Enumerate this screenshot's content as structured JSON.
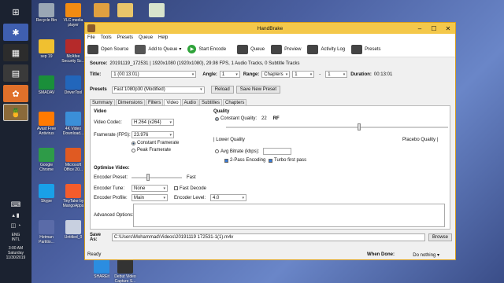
{
  "desktop": {
    "icons": [
      {
        "label": "Recycle Bin",
        "color": "#9aa7b5"
      },
      {
        "label": "VLC media player",
        "color": "#f28b12"
      },
      {
        "label": "",
        "color": "#e0a040"
      },
      {
        "label": "",
        "color": "#e8c56a"
      },
      {
        "label": "",
        "color": "#d8e4cc"
      },
      {
        "label": "sep 19",
        "color": "#f0c030"
      },
      {
        "label": "McAfee Security Sc...",
        "color": "#b52a2a"
      },
      {
        "label": "SMADAV",
        "color": "#1a8f3a"
      },
      {
        "label": "DriverTool",
        "color": "#2266bb"
      },
      {
        "label": "Avast Free Antivirus",
        "color": "#ff7a00"
      },
      {
        "label": "4K Video Download...",
        "color": "#3b8fd8"
      },
      {
        "label": "Google Chrome",
        "color": "#2e9b48"
      },
      {
        "label": "Microsoft Office 20...",
        "color": "#e05a22"
      },
      {
        "label": "Skype",
        "color": "#19a0e8"
      },
      {
        "label": "TinyTake by MangoApps",
        "color": "#f35c2c"
      },
      {
        "label": "Hetman Partitio...",
        "color": "#5a6ba8"
      },
      {
        "label": "Untitled_0",
        "color": "#c8d0e0"
      },
      {
        "label": "SHAREit",
        "color": "#2b8de0"
      },
      {
        "label": "Debut Video Capture S...",
        "color": "#333333"
      }
    ]
  },
  "taskbar": {
    "lang1": "ENG",
    "lang2": "INTL",
    "time": "3:00 AM",
    "day": "Saturday",
    "date": "11/30/2019"
  },
  "window": {
    "title": "HandBrake",
    "menu": [
      "File",
      "Tools",
      "Presets",
      "Queue",
      "Help"
    ],
    "toolbar": {
      "open_source": "Open Source",
      "add_to_queue": "Add to Queue",
      "start_encode": "Start Encode",
      "queue": "Queue",
      "preview": "Preview",
      "activity_log": "Activity Log",
      "presets": "Presets"
    },
    "source": {
      "label": "Source:",
      "value": "20191119_172531 | 1920x1080 (1920x1080), 29.98 FPS, 1 Audio Tracks, 0 Subtitle Tracks"
    },
    "title_row": {
      "title_label": "Title:",
      "title_value": "1 (00:13:01)",
      "angle_label": "Angle:",
      "angle_value": "1",
      "range_label": "Range:",
      "range_value": "Chapters",
      "range_from": "1",
      "range_sep": "-",
      "range_to": "1",
      "duration_label": "Duration:",
      "duration_value": "00:13:01"
    },
    "presets_row": {
      "label": "Presets",
      "value": "Fast 1080p30 (Modified)",
      "reload": "Reload",
      "save_new": "Save New Preset"
    },
    "tabs": [
      "Summary",
      "Dimensions",
      "Filters",
      "Video",
      "Audio",
      "Subtitles",
      "Chapters"
    ],
    "active_tab": "Video",
    "video": {
      "section": "Video",
      "codec_label": "Video Codec:",
      "codec_value": "H.264 (x264)",
      "framerate_label": "Framerate (FPS):",
      "framerate_value": "23.976",
      "constant_framerate": "Constant Framerate",
      "peak_framerate": "Peak Framerate"
    },
    "quality": {
      "section": "Quality",
      "constant_quality": "Constant Quality:",
      "cq_value": "22",
      "cq_unit": "RF",
      "slider_position": 0.6,
      "lower_quality": "| Lower Quality",
      "placebo_quality": "Placebo Quality |",
      "avg_bitrate": "Avg Bitrate (kbps):",
      "two_pass": "2-Pass Encoding",
      "turbo_first": "Turbo first pass"
    },
    "optimise": {
      "section": "Optimise Video:",
      "encoder_preset_label": "Encoder Preset:",
      "encoder_preset_value": "Fast",
      "slider_position": 0.33,
      "encoder_tune_label": "Encoder Tune:",
      "encoder_tune_value": "None",
      "fast_decode": "Fast Decode",
      "encoder_profile_label": "Encoder Profile:",
      "encoder_profile_value": "Main",
      "encoder_level_label": "Encoder Level:",
      "encoder_level_value": "4.0",
      "advanced_label": "Advanced Options:"
    },
    "save_as": {
      "label": "Save As:",
      "value": "C:\\Users\\Mohammad\\Videos\\20191119 172531-1(1).m4v",
      "browse": "Browse"
    },
    "status": {
      "ready": "Ready",
      "when_done_label": "When Done:",
      "when_done_value": "Do nothing"
    }
  },
  "colors": {
    "titlebar": "#f4c84a",
    "taskbar": "#1b2230",
    "start_green": "#2fa33a"
  }
}
